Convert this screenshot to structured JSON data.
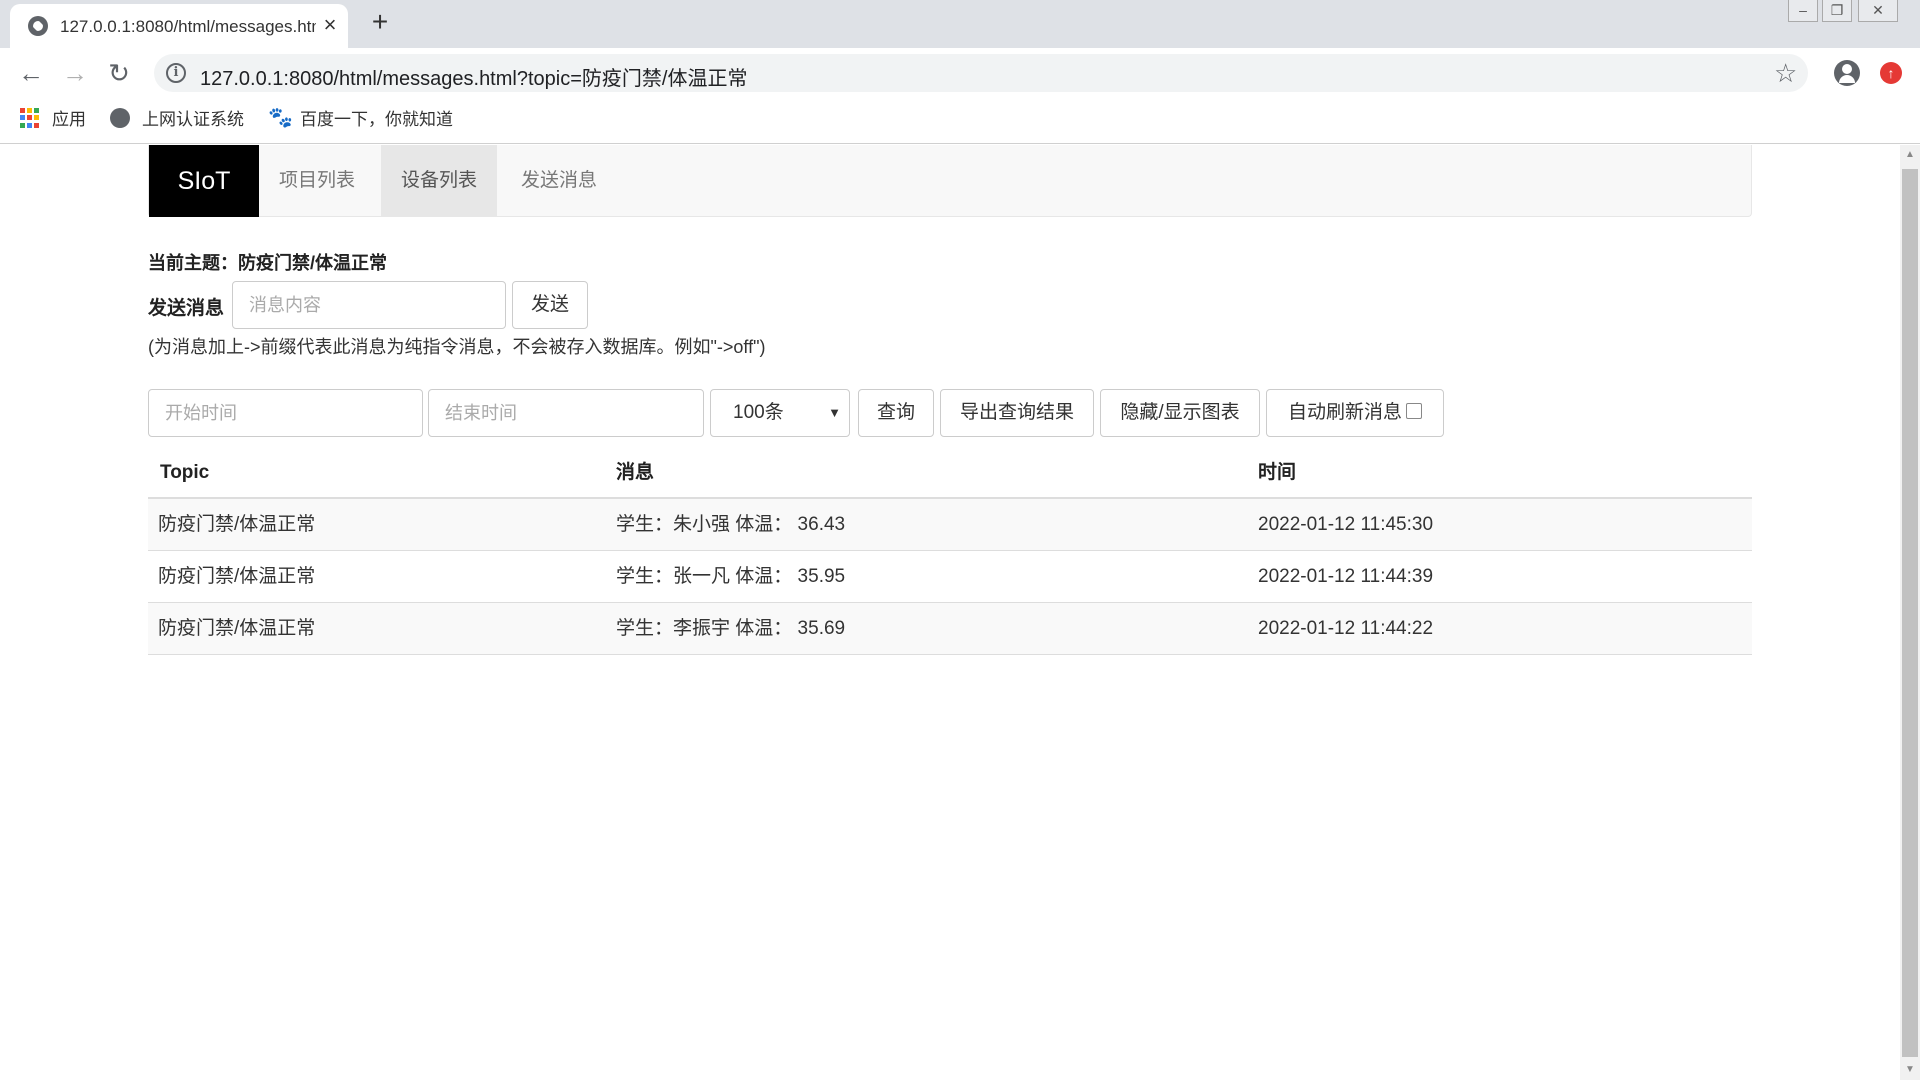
{
  "browser": {
    "tab_title": "127.0.0.1:8080/html/messages.html",
    "url": "127.0.0.1:8080/html/messages.html?topic=防疫门禁/体温正常",
    "bookmarks": [
      {
        "label": "应用",
        "icon": "apps-grid-icon"
      },
      {
        "label": "上网认证系统",
        "icon": "globe-icon"
      },
      {
        "label": "百度一下，你就知道",
        "icon": "baidu-paw-icon"
      }
    ]
  },
  "navbar": {
    "brand": "SIoT",
    "items": [
      {
        "label": "项目列表",
        "active": false
      },
      {
        "label": "设备列表",
        "active": true
      },
      {
        "label": "发送消息",
        "active": false
      }
    ]
  },
  "topic": {
    "text": "当前主题：防疫门禁/体温正常"
  },
  "send": {
    "label": "发送消息",
    "input_placeholder": "消息内容",
    "button": "发送",
    "hint": "(为消息加上->前缀代表此消息为纯指令消息，不会被存入数据库。例如\"->off\")"
  },
  "query": {
    "start_placeholder": "开始时间",
    "end_placeholder": "结束时间",
    "limit_selected": "100条",
    "query_button": "查询",
    "export_button": "导出查询结果",
    "toggle_chart_button": "隐藏/显示图表",
    "auto_refresh_label": "自动刷新消息",
    "auto_refresh_checked": false
  },
  "table": {
    "headers": [
      "Topic",
      "消息",
      "时间"
    ],
    "rows": [
      {
        "topic": "防疫门禁/体温正常",
        "message": "学生：朱小强 体温： 36.43",
        "time": "2022-01-12 11:45:30"
      },
      {
        "topic": "防疫门禁/体温正常",
        "message": "学生：张一凡 体温： 35.95",
        "time": "2022-01-12 11:44:39"
      },
      {
        "topic": "防疫门禁/体温正常",
        "message": "学生：李振宇 体温： 35.69",
        "time": "2022-01-12 11:44:22"
      }
    ]
  },
  "colors": {
    "brand_bg": "#000000",
    "navbar_bg": "#f8f8f8",
    "update_badge": "#e53935"
  }
}
